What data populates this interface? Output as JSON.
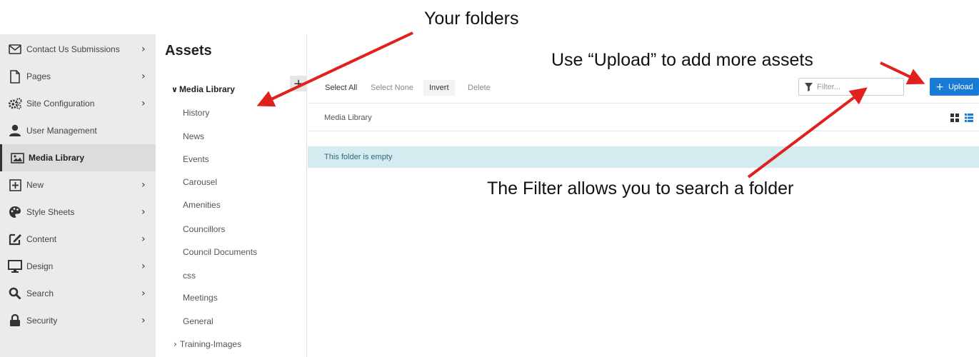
{
  "sidebar": {
    "items": [
      {
        "label": "Contact Us Submissions",
        "icon": "envelope-icon",
        "chevron": "›"
      },
      {
        "label": "Pages",
        "icon": "page-icon",
        "chevron": "›"
      },
      {
        "label": "Site Configuration",
        "icon": "gears-icon",
        "chevron": "›"
      },
      {
        "label": "User Management",
        "icon": "user-icon",
        "chevron": ""
      },
      {
        "label": "Media Library",
        "icon": "image-icon",
        "chevron": "",
        "active": true
      },
      {
        "label": "New",
        "icon": "plus-square-icon",
        "chevron": "›"
      },
      {
        "label": "Style Sheets",
        "icon": "palette-icon",
        "chevron": "›"
      },
      {
        "label": "Content",
        "icon": "edit-icon",
        "chevron": "›"
      },
      {
        "label": "Design",
        "icon": "monitor-icon",
        "chevron": "›"
      },
      {
        "label": "Search",
        "icon": "search-icon",
        "chevron": "›"
      },
      {
        "label": "Security",
        "icon": "lock-icon",
        "chevron": "›"
      }
    ]
  },
  "assets": {
    "title": "Assets",
    "add_symbol": "+",
    "root_label": "Media Library",
    "root_toggle": "∨",
    "folders": [
      "History",
      "News",
      "Events",
      "Carousel",
      "Amenities",
      "Councillors",
      "Council Documents",
      "css",
      "Meetings",
      "General"
    ],
    "collapsed_folder": {
      "toggle": "›",
      "label": "Training-Images"
    }
  },
  "toolbar": {
    "select_all": "Select All",
    "select_none": "Select None",
    "invert": "Invert",
    "delete": "Delete",
    "filter_placeholder": "Filter...",
    "upload_plus": "+",
    "upload_label": "Upload"
  },
  "main": {
    "breadcrumb": "Media Library",
    "empty_message": "This folder is empty"
  },
  "annotations": {
    "your_folders": "Your folders",
    "upload_hint": "Use “Upload” to add more assets",
    "filter_hint": "The Filter allows you to search a folder"
  },
  "colors": {
    "accent": "#1a7bd6",
    "annotation_arrow": "#e0211f",
    "empty_banner": "#d4ebf0"
  }
}
